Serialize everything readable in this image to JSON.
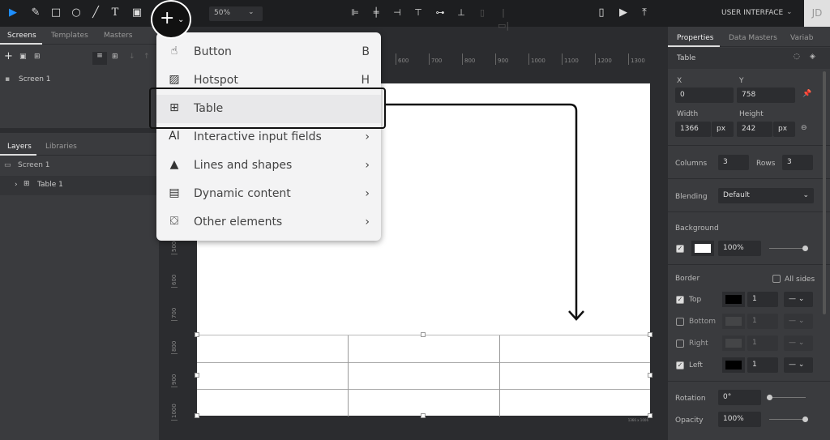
{
  "toolbar": {
    "zoom": "50%",
    "project": "USER INTERFACE",
    "avatar": "JD"
  },
  "left": {
    "tabs": [
      "Screens",
      "Templates",
      "Masters"
    ],
    "screens": [
      "Screen 1"
    ],
    "layer_tabs": [
      "Layers",
      "Libraries"
    ],
    "layer_screen": "Screen 1",
    "layer_item": "Table 1"
  },
  "menu": {
    "items": [
      {
        "label": "Button",
        "key": "B"
      },
      {
        "label": "Hotspot",
        "key": "H"
      },
      {
        "label": "Table",
        "key": ""
      },
      {
        "label": "Interactive input fields",
        "key": "›"
      },
      {
        "label": "Lines and shapes",
        "key": "›"
      },
      {
        "label": "Dynamic content",
        "key": "›"
      },
      {
        "label": "Other elements",
        "key": "›"
      }
    ]
  },
  "ruler": {
    "top": [
      "600",
      "700",
      "800",
      "900",
      "1000",
      "1100",
      "1200",
      "1300"
    ],
    "left": [
      "500",
      "600",
      "700",
      "800",
      "900",
      "1000"
    ]
  },
  "canvas": {
    "size_label": "1366 x 1006"
  },
  "props": {
    "tabs": [
      "Properties",
      "Data Masters",
      "Variab"
    ],
    "element": "Table",
    "x_label": "X",
    "y_label": "Y",
    "x": "0",
    "y": "758",
    "w_label": "Width",
    "h_label": "Height",
    "w": "1366",
    "h": "242",
    "unit": "px",
    "columns_label": "Columns",
    "columns": "3",
    "rows_label": "Rows",
    "rows": "3",
    "blending_label": "Blending",
    "blending": "Default",
    "background_label": "Background",
    "bg_opacity": "100%",
    "border_label": "Border",
    "all_sides": "All sides",
    "sides": [
      {
        "label": "Top",
        "checked": true,
        "w": "1"
      },
      {
        "label": "Bottom",
        "checked": false,
        "w": "1"
      },
      {
        "label": "Right",
        "checked": false,
        "w": "1"
      },
      {
        "label": "Left",
        "checked": true,
        "w": "1"
      }
    ],
    "rotation_label": "Rotation",
    "rotation": "0°",
    "opacity_label": "Opacity",
    "opacity": "100%"
  }
}
